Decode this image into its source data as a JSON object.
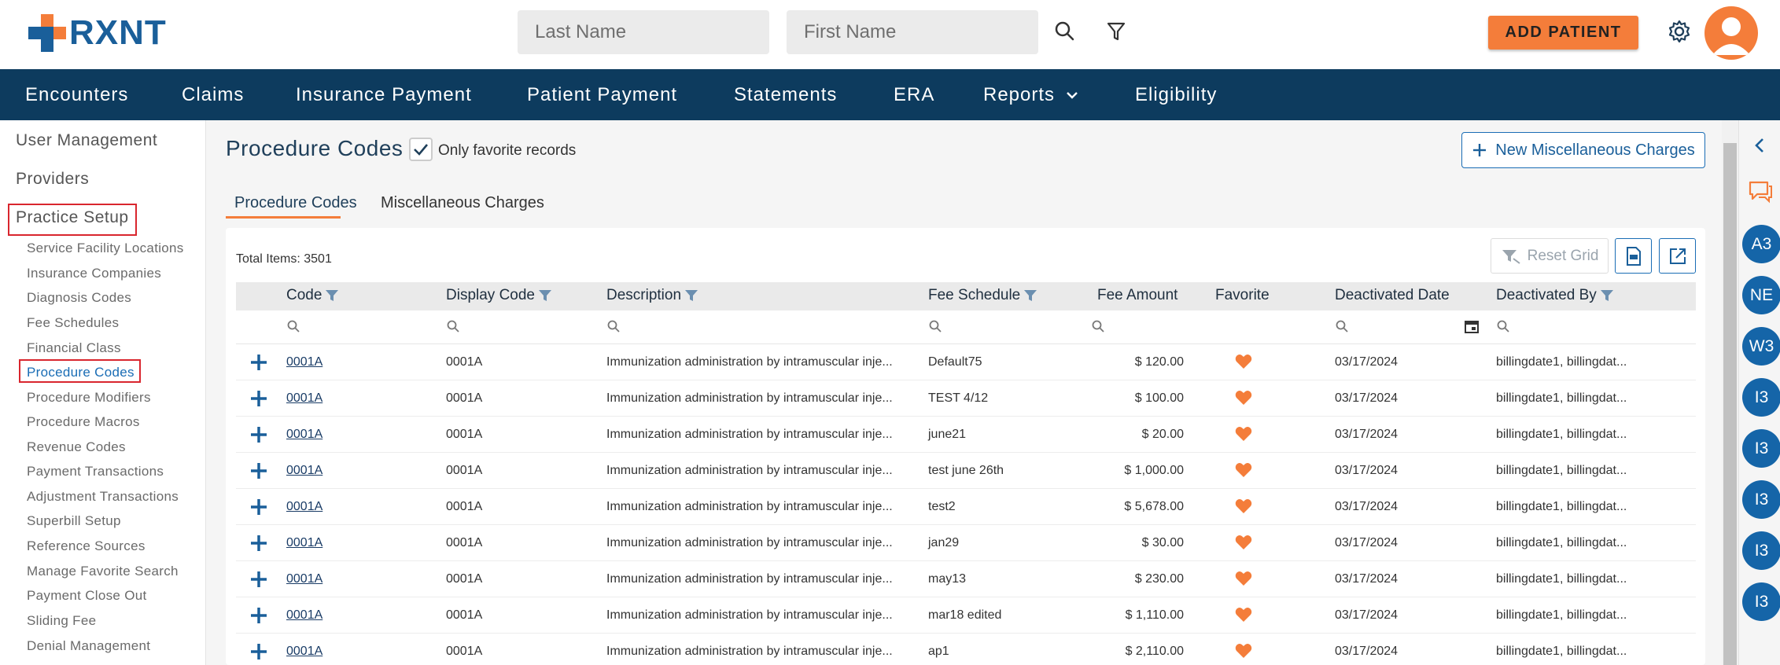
{
  "header": {
    "logo_text": "RXNT",
    "last_name_placeholder": "Last Name",
    "first_name_placeholder": "First Name",
    "add_patient_label": "ADD PATIENT"
  },
  "nav": {
    "items": [
      "Encounters",
      "Claims",
      "Insurance Payment",
      "Patient Payment",
      "Statements",
      "ERA",
      "Reports",
      "Eligibility"
    ]
  },
  "sidebar": {
    "top_items": [
      "User Management",
      "Providers",
      "Practice Setup"
    ],
    "sub_items": [
      "Service Facility Locations",
      "Insurance Companies",
      "Diagnosis Codes",
      "Fee Schedules",
      "Financial Class",
      "Procedure Codes",
      "Procedure Modifiers",
      "Procedure Macros",
      "Revenue Codes",
      "Payment Transactions",
      "Adjustment Transactions",
      "Superbill Setup",
      "Reference Sources",
      "Manage Favorite Search",
      "Payment Close Out",
      "Sliding Fee",
      "Denial Management"
    ],
    "active_sub": "Procedure Codes"
  },
  "page": {
    "title": "Procedure Codes",
    "favorite_label": "Only favorite records",
    "new_misc_label": "New Miscellaneous Charges",
    "tabs": [
      "Procedure Codes",
      "Miscellaneous Charges"
    ],
    "total_items": "Total Items: 3501",
    "reset_grid_label": "Reset Grid"
  },
  "table": {
    "columns": [
      "Code",
      "Display Code",
      "Description",
      "Fee Schedule",
      "Fee Amount",
      "Favorite",
      "Deactivated Date",
      "Deactivated By"
    ],
    "rows": [
      {
        "code": "0001A",
        "display_code": "0001A",
        "description": "Immunization administration by intramuscular inje...",
        "fee_schedule": "Default75",
        "fee_amount": "$ 120.00",
        "deactivated_date": "03/17/2024",
        "deactivated_by": "billingdate1, billingdat..."
      },
      {
        "code": "0001A",
        "display_code": "0001A",
        "description": "Immunization administration by intramuscular inje...",
        "fee_schedule": "TEST 4/12",
        "fee_amount": "$ 100.00",
        "deactivated_date": "03/17/2024",
        "deactivated_by": "billingdate1, billingdat..."
      },
      {
        "code": "0001A",
        "display_code": "0001A",
        "description": "Immunization administration by intramuscular inje...",
        "fee_schedule": "june21",
        "fee_amount": "$ 20.00",
        "deactivated_date": "03/17/2024",
        "deactivated_by": "billingdate1, billingdat..."
      },
      {
        "code": "0001A",
        "display_code": "0001A",
        "description": "Immunization administration by intramuscular inje...",
        "fee_schedule": "test june 26th",
        "fee_amount": "$ 1,000.00",
        "deactivated_date": "03/17/2024",
        "deactivated_by": "billingdate1, billingdat..."
      },
      {
        "code": "0001A",
        "display_code": "0001A",
        "description": "Immunization administration by intramuscular inje...",
        "fee_schedule": "test2",
        "fee_amount": "$ 5,678.00",
        "deactivated_date": "03/17/2024",
        "deactivated_by": "billingdate1, billingdat..."
      },
      {
        "code": "0001A",
        "display_code": "0001A",
        "description": "Immunization administration by intramuscular inje...",
        "fee_schedule": "jan29",
        "fee_amount": "$ 30.00",
        "deactivated_date": "03/17/2024",
        "deactivated_by": "billingdate1, billingdat..."
      },
      {
        "code": "0001A",
        "display_code": "0001A",
        "description": "Immunization administration by intramuscular inje...",
        "fee_schedule": "may13",
        "fee_amount": "$ 230.00",
        "deactivated_date": "03/17/2024",
        "deactivated_by": "billingdate1, billingdat..."
      },
      {
        "code": "0001A",
        "display_code": "0001A",
        "description": "Immunization administration by intramuscular inje...",
        "fee_schedule": "mar18 edited",
        "fee_amount": "$ 1,110.00",
        "deactivated_date": "03/17/2024",
        "deactivated_by": "billingdate1, billingdat..."
      },
      {
        "code": "0001A",
        "display_code": "0001A",
        "description": "Immunization administration by intramuscular inje...",
        "fee_schedule": "ap1",
        "fee_amount": "$ 2,110.00",
        "deactivated_date": "03/17/2024",
        "deactivated_by": "billingdate1, billingdat..."
      }
    ]
  },
  "right_rail": {
    "badges": [
      "A3",
      "NE",
      "W3",
      "I3",
      "I3",
      "I3",
      "I3",
      "I3"
    ]
  },
  "colors": {
    "brand_blue": "#1a5f9a",
    "nav_bg": "#0d3b5e",
    "accent_orange": "#f47d3a",
    "highlight_red": "#d9262e"
  }
}
